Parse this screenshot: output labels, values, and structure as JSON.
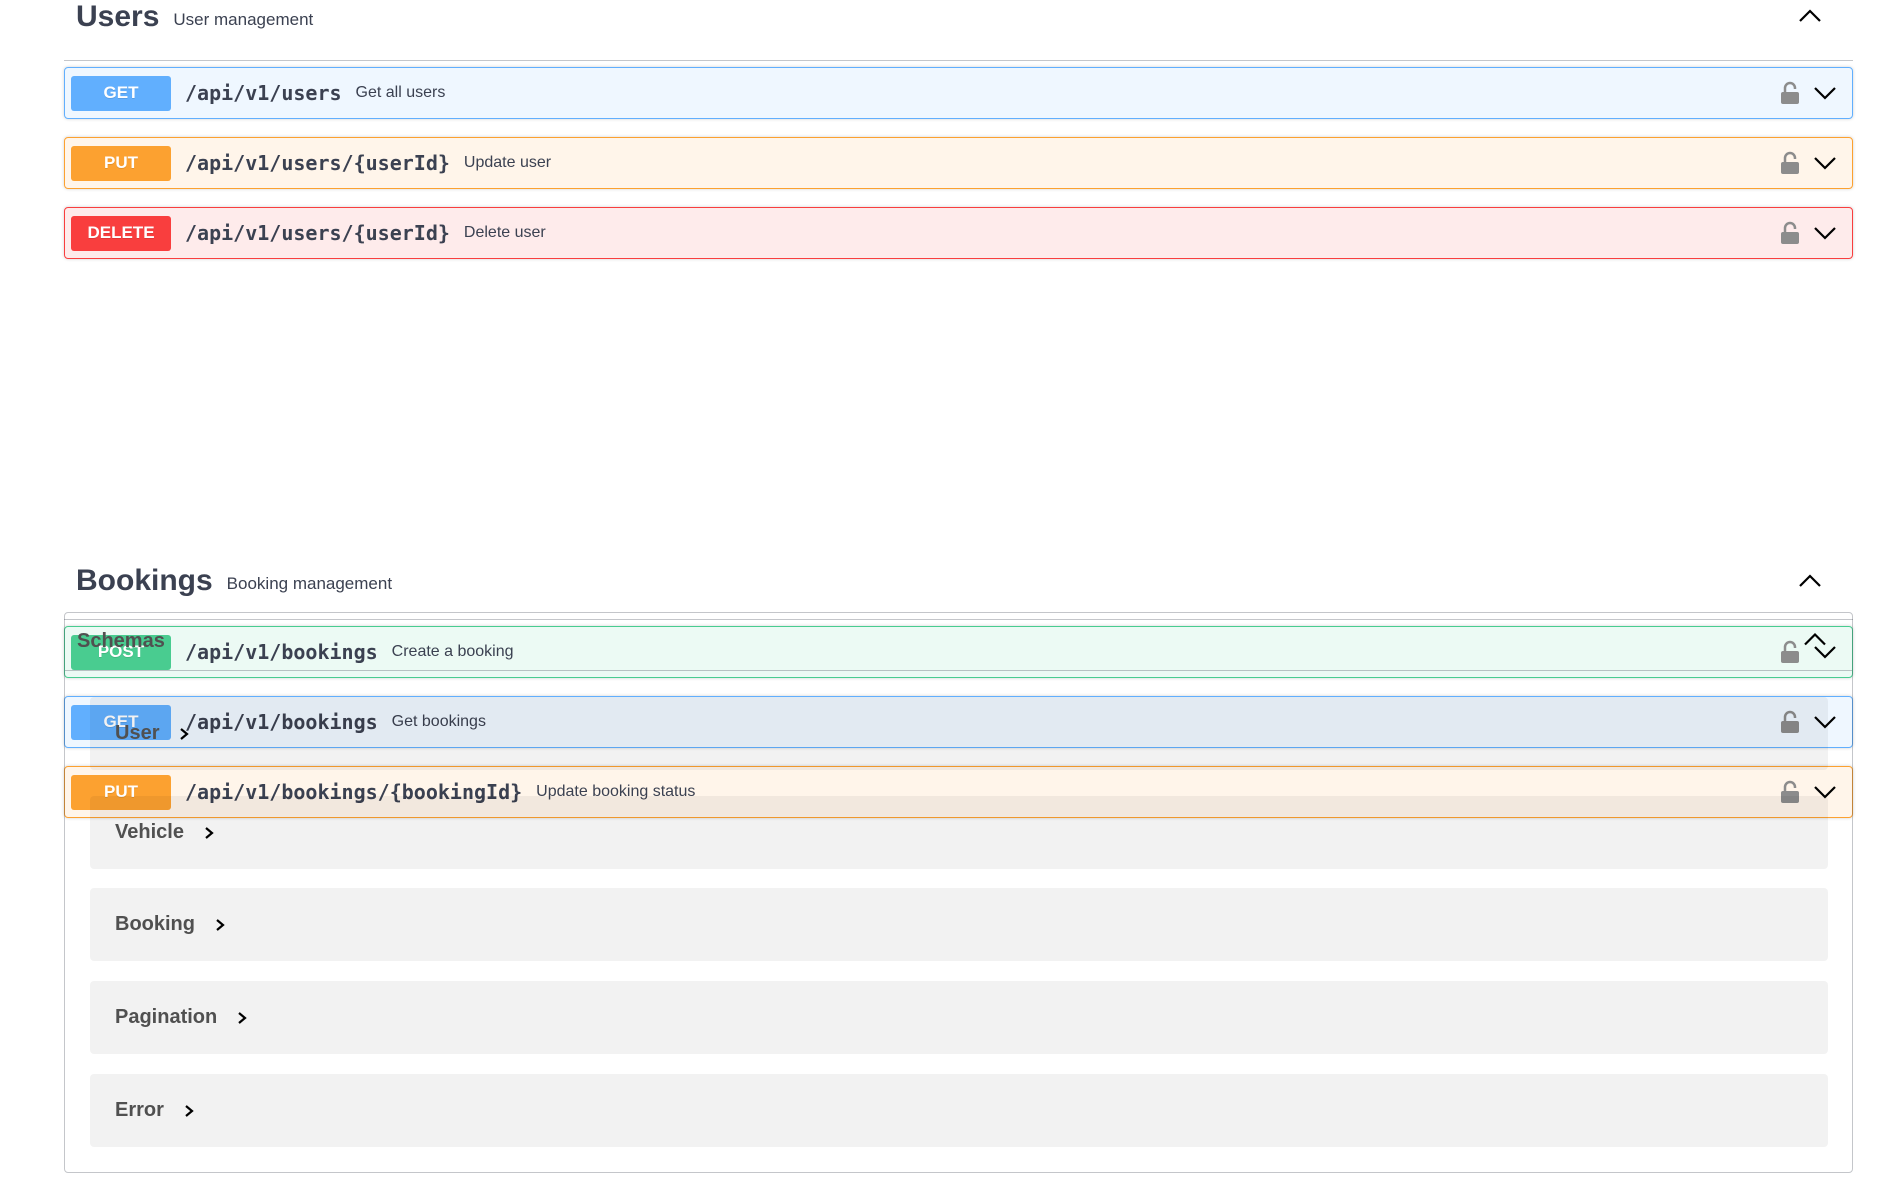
{
  "colors": {
    "get": "#61affe",
    "put": "#fca130",
    "delete": "#f93e3e",
    "post": "#49cc90",
    "text": "#3b4151"
  },
  "tags": [
    {
      "name": "Users",
      "description": "User management",
      "toggle_icon": "chevron-up-icon",
      "operations": [
        {
          "method": "GET",
          "path": "/api/v1/users",
          "summary": "Get all users",
          "lock_icon": "unlocked-padlock-icon",
          "expand_icon": "chevron-down-icon"
        },
        {
          "method": "PUT",
          "path": "/api/v1/users/{userId}",
          "summary": "Update user",
          "lock_icon": "unlocked-padlock-icon",
          "expand_icon": "chevron-down-icon"
        },
        {
          "method": "DELETE",
          "path": "/api/v1/users/{userId}",
          "summary": "Delete user",
          "lock_icon": "unlocked-padlock-icon",
          "expand_icon": "chevron-down-icon"
        }
      ]
    },
    {
      "name": "Bookings",
      "description": "Booking management",
      "toggle_icon": "chevron-up-icon",
      "operations": [
        {
          "method": "POST",
          "path": "/api/v1/bookings",
          "summary": "Create a booking",
          "lock_icon": "unlocked-padlock-icon",
          "expand_icon": "chevron-down-icon"
        },
        {
          "method": "GET",
          "path": "/api/v1/bookings",
          "summary": "Get bookings",
          "lock_icon": "unlocked-padlock-icon",
          "expand_icon": "chevron-down-icon"
        },
        {
          "method": "PUT",
          "path": "/api/v1/bookings/{bookingId}",
          "summary": "Update booking status",
          "lock_icon": "unlocked-padlock-icon",
          "expand_icon": "chevron-down-icon"
        }
      ]
    }
  ],
  "schemas": {
    "title": "Schemas",
    "toggle_icon": "chevron-up-icon",
    "models": [
      {
        "name": "User",
        "expand_icon": "chevron-right-icon"
      },
      {
        "name": "Vehicle",
        "expand_icon": "chevron-right-icon"
      },
      {
        "name": "Booking",
        "expand_icon": "chevron-right-icon"
      },
      {
        "name": "Pagination",
        "expand_icon": "chevron-right-icon"
      },
      {
        "name": "Error",
        "expand_icon": "chevron-right-icon"
      }
    ]
  }
}
